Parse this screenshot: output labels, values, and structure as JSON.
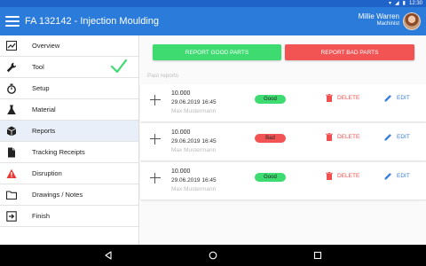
{
  "status_bar": {
    "time": "12:30",
    "icons": [
      "wifi-icon",
      "signal-icon",
      "battery-icon"
    ]
  },
  "app_bar": {
    "title": "FA 132142 - Injection Moulding",
    "user_name": "Millie Warren",
    "user_role": "Machinist",
    "color": "#2b7bdb"
  },
  "sidebar": {
    "items": [
      {
        "label": "Overview",
        "icon": "chart-icon",
        "active": false,
        "checked": false
      },
      {
        "label": "Tool",
        "icon": "wrench-icon",
        "active": false,
        "checked": true
      },
      {
        "label": "Setup",
        "icon": "stopwatch-icon",
        "active": false,
        "checked": false
      },
      {
        "label": "Material",
        "icon": "flask-icon",
        "active": false,
        "checked": false
      },
      {
        "label": "Reports",
        "icon": "cube-icon",
        "active": true,
        "checked": false
      },
      {
        "label": "Tracking Receipts",
        "icon": "document-icon",
        "active": false,
        "checked": false
      },
      {
        "label": "Disruption",
        "icon": "warning-icon",
        "active": false,
        "checked": false
      },
      {
        "label": "Drawings / Notes",
        "icon": "folder-icon",
        "active": false,
        "checked": false
      },
      {
        "label": "Finish",
        "icon": "exit-icon",
        "active": false,
        "checked": false
      }
    ]
  },
  "main": {
    "report_good_label": "REPORT GOOD PARTS",
    "report_bad_label": "REPORT BAD PARTS",
    "past_reports_label": "Past  reports",
    "delete_label": "DELETE",
    "edit_label": "EDIT",
    "reports": [
      {
        "quantity": "10.000",
        "date": "29.06.2019 16:45",
        "worker": "Max Mustermann",
        "status": "Good"
      },
      {
        "quantity": "10.000",
        "date": "29.06.2019 16:45",
        "worker": "Max Mustermann",
        "status": "Bad"
      },
      {
        "quantity": "10.000",
        "date": "29.06.2019 16:45",
        "worker": "Max Mustermann",
        "status": "Good"
      }
    ]
  },
  "colors": {
    "good": "#3ddb70",
    "bad": "#f25454",
    "accent": "#2b7bdb",
    "delete": "#f05050"
  }
}
